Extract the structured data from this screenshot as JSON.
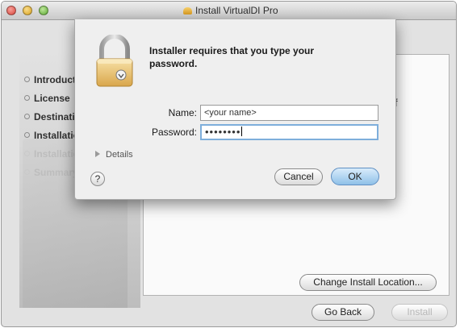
{
  "window": {
    "title": "Install VirtualDI Pro"
  },
  "sidebar": {
    "items": [
      {
        "label": "Introduction",
        "state": "done"
      },
      {
        "label": "License",
        "state": "done"
      },
      {
        "label": "Destination Select",
        "state": "done"
      },
      {
        "label": "Installation Type",
        "state": "current"
      },
      {
        "label": "Installation",
        "state": "pending"
      },
      {
        "label": "Summary",
        "state": "pending"
      }
    ]
  },
  "content": {
    "partial_text": "f",
    "change_location_label": "Change Install Location...",
    "go_back_label": "Go Back",
    "install_label": "Install"
  },
  "auth_dialog": {
    "message": "Installer requires that you type your password.",
    "name_label": "Name:",
    "name_value": "<your name>",
    "password_label": "Password:",
    "password_mask": "••••••••",
    "details_label": "Details",
    "help_label": "?",
    "cancel_label": "Cancel",
    "ok_label": "OK",
    "icon": "padlock-icon"
  },
  "colors": {
    "default_button": "#8fc0e8",
    "focus_ring": "#7eaedb",
    "window_bg": "#e2e2e2"
  }
}
